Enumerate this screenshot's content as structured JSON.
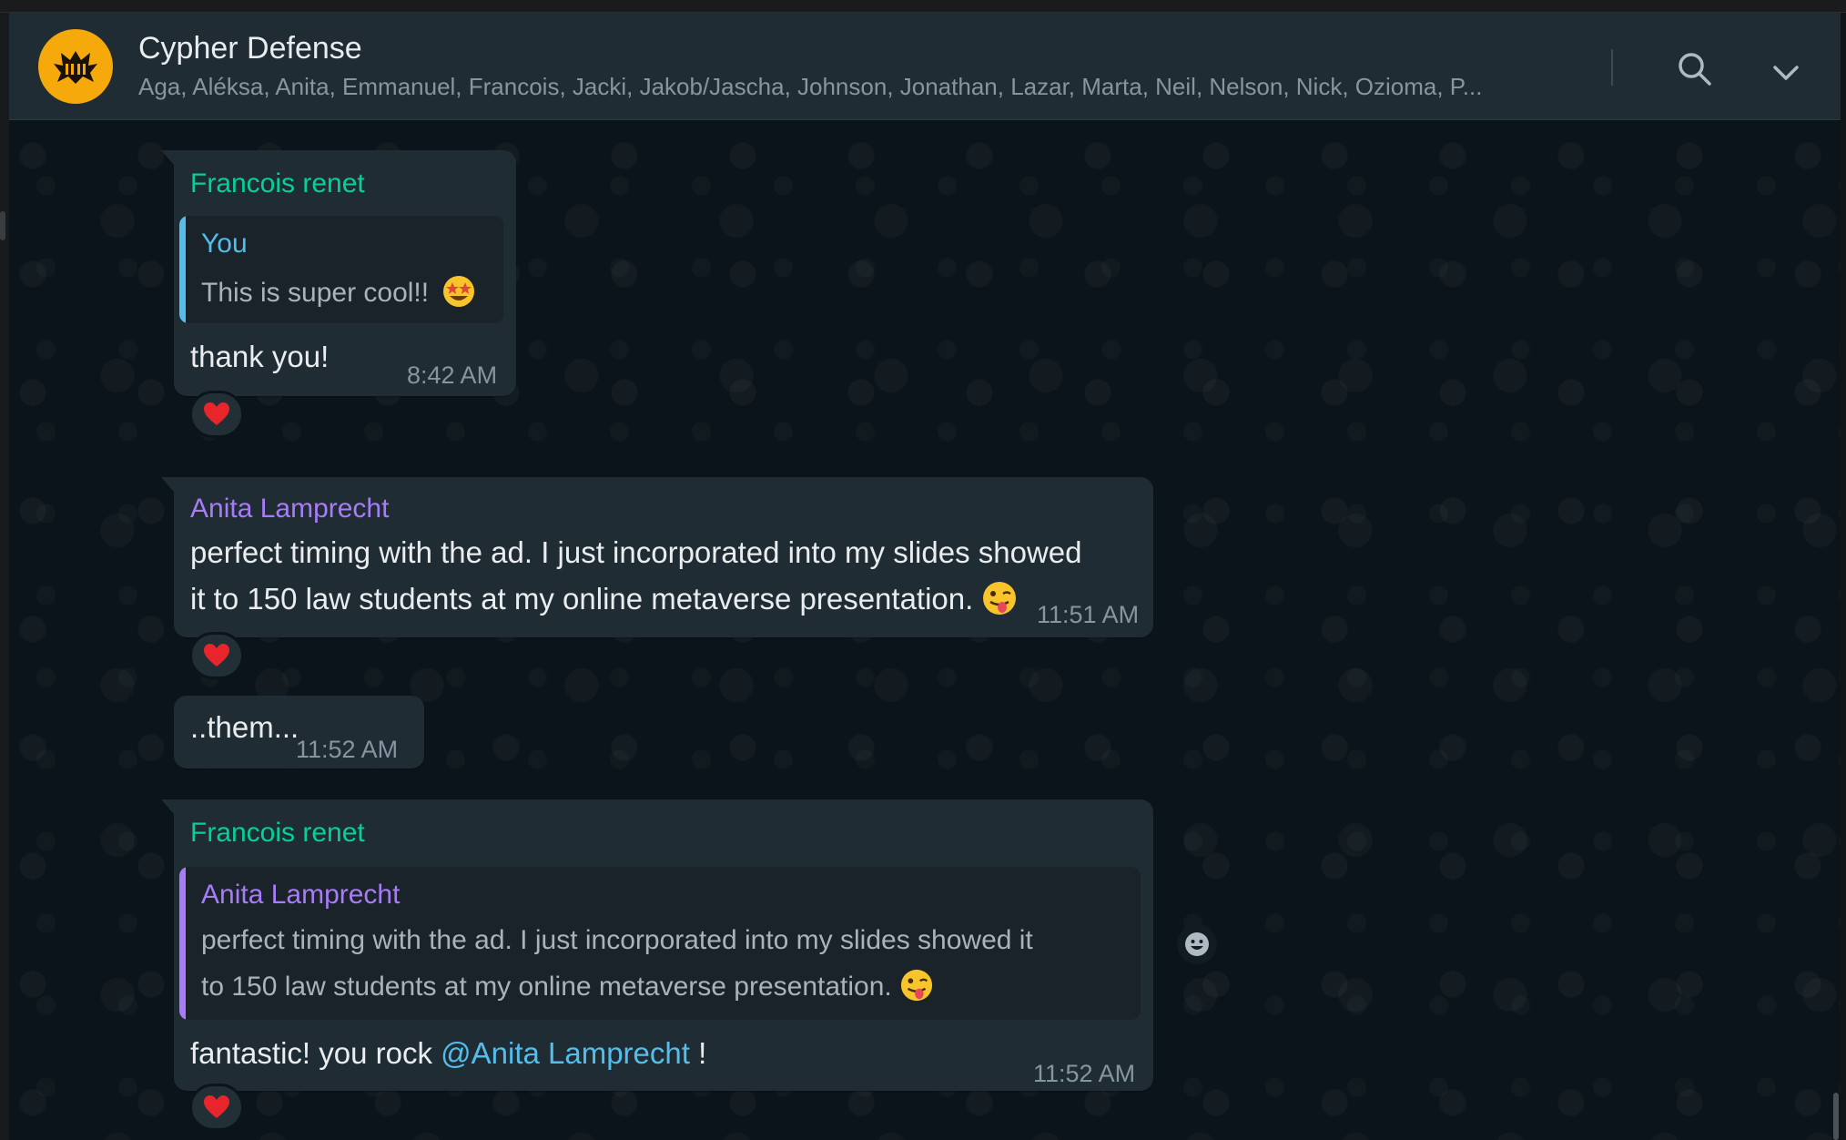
{
  "header": {
    "title": "Cypher Defense",
    "members": "Aga, Aléksa, Anita, Emmanuel, Francois, Jacki, Jakob/Jascha, Johnson, Jonathan, Lazar, Marta, Neil, Nelson, Nick, Ozioma, P..."
  },
  "messages": [
    {
      "sender": "Francois renet",
      "quote_sender": "You",
      "quote_text": "This is super cool!!",
      "text": "thank you!",
      "time": "8:42 AM",
      "reaction": "heart"
    },
    {
      "sender": "Anita Lamprecht",
      "text_line1": "perfect timing with the ad. I just incorporated into my slides showed",
      "text_line2": "it to 150 law students at my online metaverse presentation.",
      "time": "11:51 AM",
      "reaction": "heart"
    },
    {
      "text": "..them...",
      "time": "11:52 AM"
    },
    {
      "sender": "Francois renet",
      "quote_sender": "Anita Lamprecht",
      "quote_line1": "perfect timing with the ad. I just incorporated into my slides showed it",
      "quote_line2": "to 150 law students at my online metaverse presentation.",
      "text_prefix": "fantastic! you rock ",
      "mention": "@Anita Lamprecht",
      "text_suffix": " !",
      "time": "11:52 AM",
      "reaction": "heart"
    }
  ],
  "colors": {
    "sender_green": "#06cf9c",
    "sender_purple": "#a77cf6",
    "quote_you_blue": "#53bdeb",
    "bubble": "#202c33",
    "header": "#202c33"
  }
}
